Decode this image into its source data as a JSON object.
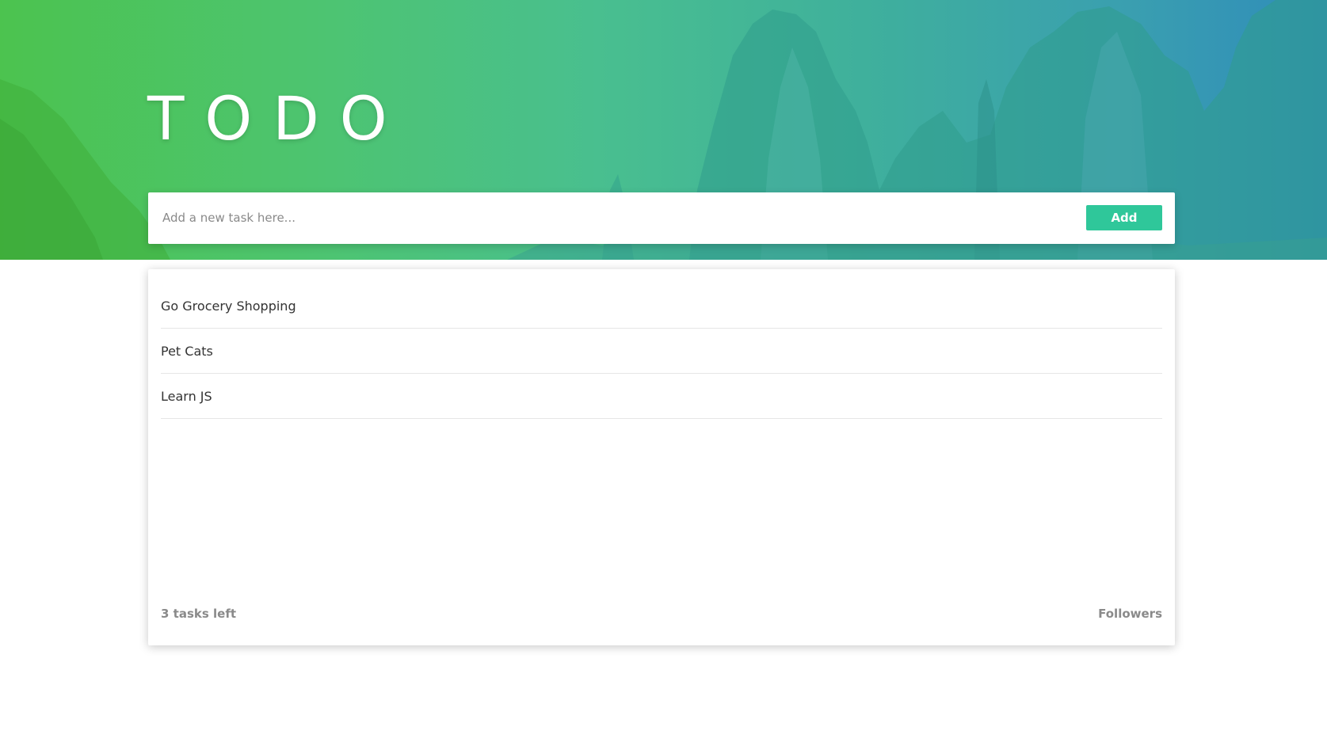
{
  "header": {
    "title": "TODO"
  },
  "add_task": {
    "placeholder": "Add a new task here...",
    "value": "",
    "button_label": "Add"
  },
  "tasks": [
    {
      "label": "Go Grocery Shopping"
    },
    {
      "label": "Pet Cats"
    },
    {
      "label": "Learn JS"
    }
  ],
  "footer": {
    "tasks_left": "3 tasks left",
    "followers_label": "Followers"
  },
  "colors": {
    "gradient_start": "#4cc34f",
    "gradient_end": "#2f8cba",
    "accent": "#2fc79a",
    "footer_text": "#8a8a8a"
  }
}
